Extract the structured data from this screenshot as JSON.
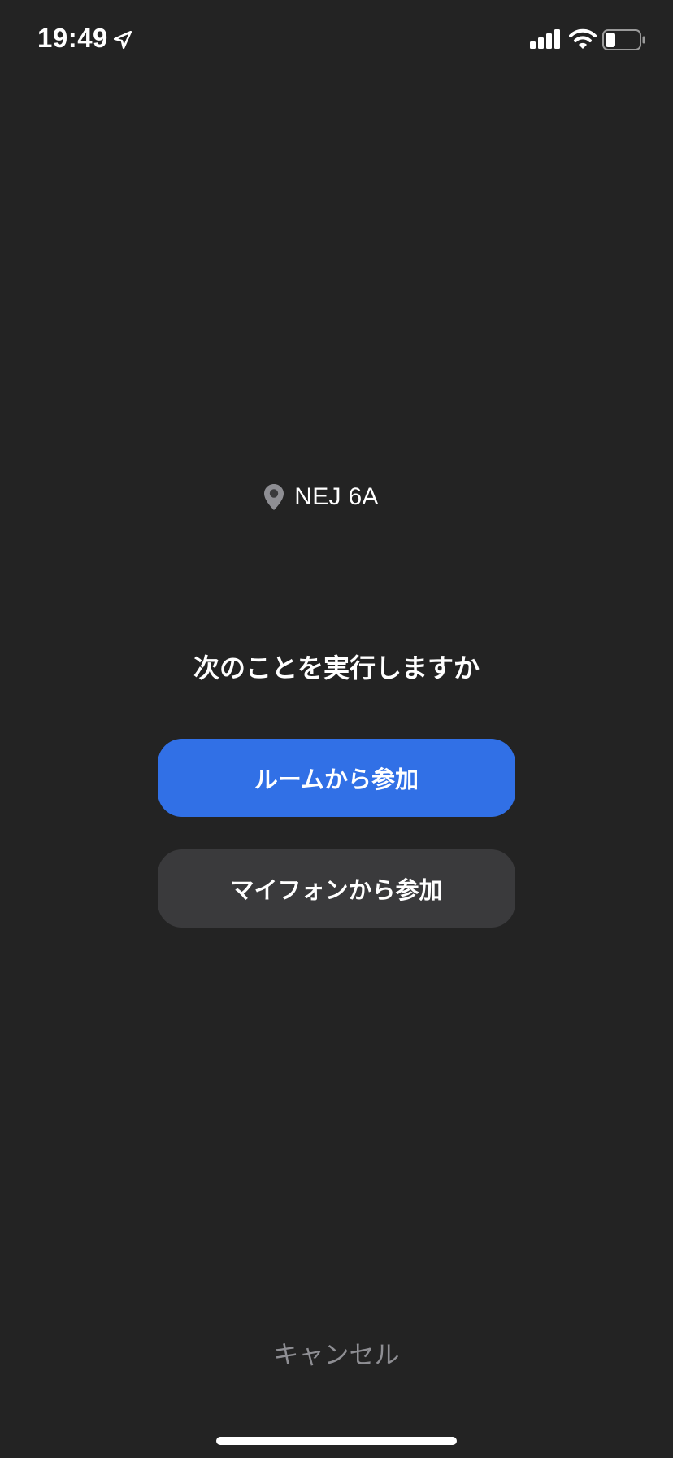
{
  "status_bar": {
    "time": "19:49",
    "location_icon": "location-arrow-icon",
    "signal_icon": "cellular-signal-icon",
    "wifi_icon": "wifi-icon",
    "battery_icon": "battery-icon",
    "battery_level": 0.3
  },
  "location": {
    "icon": "map-pin-icon",
    "name": "NEJ 6A"
  },
  "prompt": {
    "question": "次のことを実行しますか"
  },
  "actions": {
    "join_from_room": "ルームから参加",
    "join_from_phone": "マイフォンから参加"
  },
  "cancel": {
    "label": "キャンセル"
  },
  "colors": {
    "background": "#232323",
    "primary_button": "#3170e6",
    "secondary_button": "#3a3a3c",
    "cancel_text": "#8e8e93",
    "pin": "#8e8e93"
  }
}
